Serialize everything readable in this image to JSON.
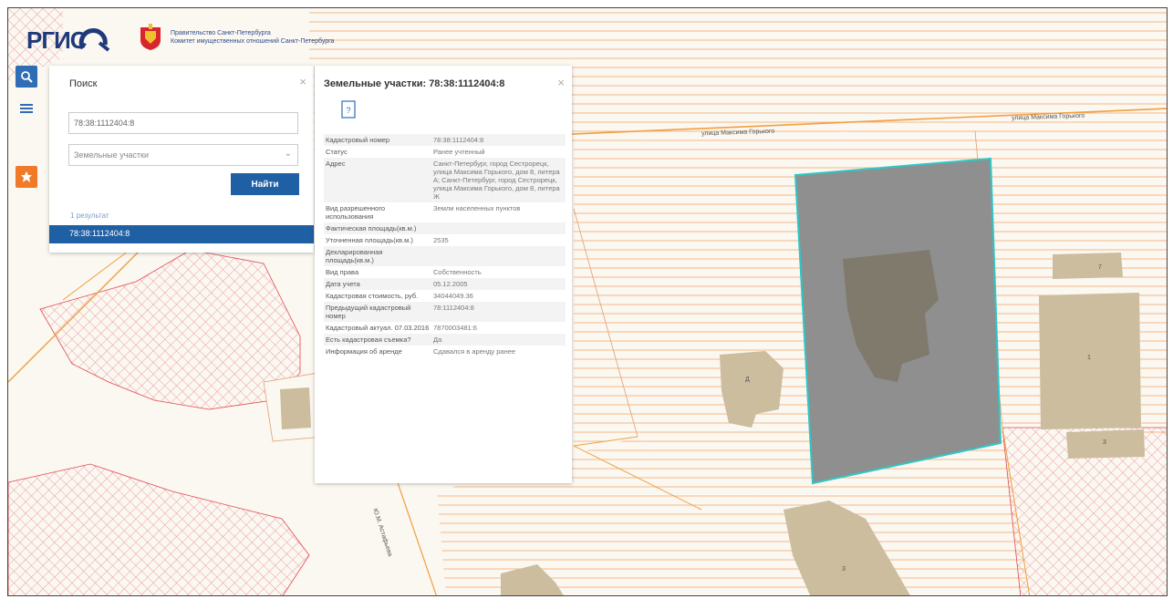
{
  "header": {
    "logo_text": "РГИС",
    "gov_line_1": "Правительство Санкт-Петербурга",
    "gov_line_2": "Комитет имущественных отношений Санкт-Петербурга"
  },
  "toolbar": {
    "search_icon": "search-icon",
    "menu_icon": "menu-icon",
    "layers_icon": "layers-icon"
  },
  "search": {
    "title": "Поиск",
    "input_value": "78:38:1112404:8",
    "type_value": "Земельные участки",
    "find_label": "Найти",
    "results_count": "1 результат",
    "result_item": "78:38:1112404:8"
  },
  "info": {
    "title": "Земельные участки: 78:38:1112404:8",
    "rows": [
      {
        "key": "Кадастровый номер",
        "value": "78:38:1112404:8"
      },
      {
        "key": "Статус",
        "value": "Ранее учтенный"
      },
      {
        "key": "Адрес",
        "value": "Санкт-Петербург, город Сестрорецк, улица Максима Горького, дом 8, литера А; Санкт-Петербург, город Сестрорецк, улица Максима Горького, дом 8, литера Ж"
      },
      {
        "key": "Вид разрешенного использования",
        "value": "Земли населенных пунктов"
      },
      {
        "key": "Фактическая площадь(кв.м.)",
        "value": ""
      },
      {
        "key": "Уточненная площадь(кв.м.)",
        "value": "2535"
      },
      {
        "key": "Декларированная площадь(кв.м.)",
        "value": ""
      },
      {
        "key": "Вид права",
        "value": "Собственность"
      },
      {
        "key": "Дата учета",
        "value": "05.12.2005"
      },
      {
        "key": "Кадастровая стоимость, руб.",
        "value": "34044049.36"
      },
      {
        "key": "Предыдущий кадастровый номер",
        "value": "78:1112404:8"
      },
      {
        "key": "Кадастровый актуал. 07.03.2016",
        "value": "7870003481:6"
      },
      {
        "key": "Есть кадастровая съемка?",
        "value": "Да"
      },
      {
        "key": "Информация об аренде",
        "value": "Сдавался в аренду ранее"
      }
    ]
  },
  "map": {
    "street_1": "улица Максима Горького",
    "street_2": "улица Максима Горького",
    "street_3": "Ю.М. Астафьева",
    "building_labels": [
      "Д",
      "7",
      "1",
      "3",
      "3"
    ],
    "colors": {
      "hatch_red": "#e04a50",
      "hatch_orange": "#f3b27a",
      "road_orange": "#f0a040",
      "building": "#cbbd9d",
      "selected_fill": "#8f8f8f",
      "selected_border": "#2fc7c7",
      "accent_blue": "#1f5fa3"
    }
  }
}
